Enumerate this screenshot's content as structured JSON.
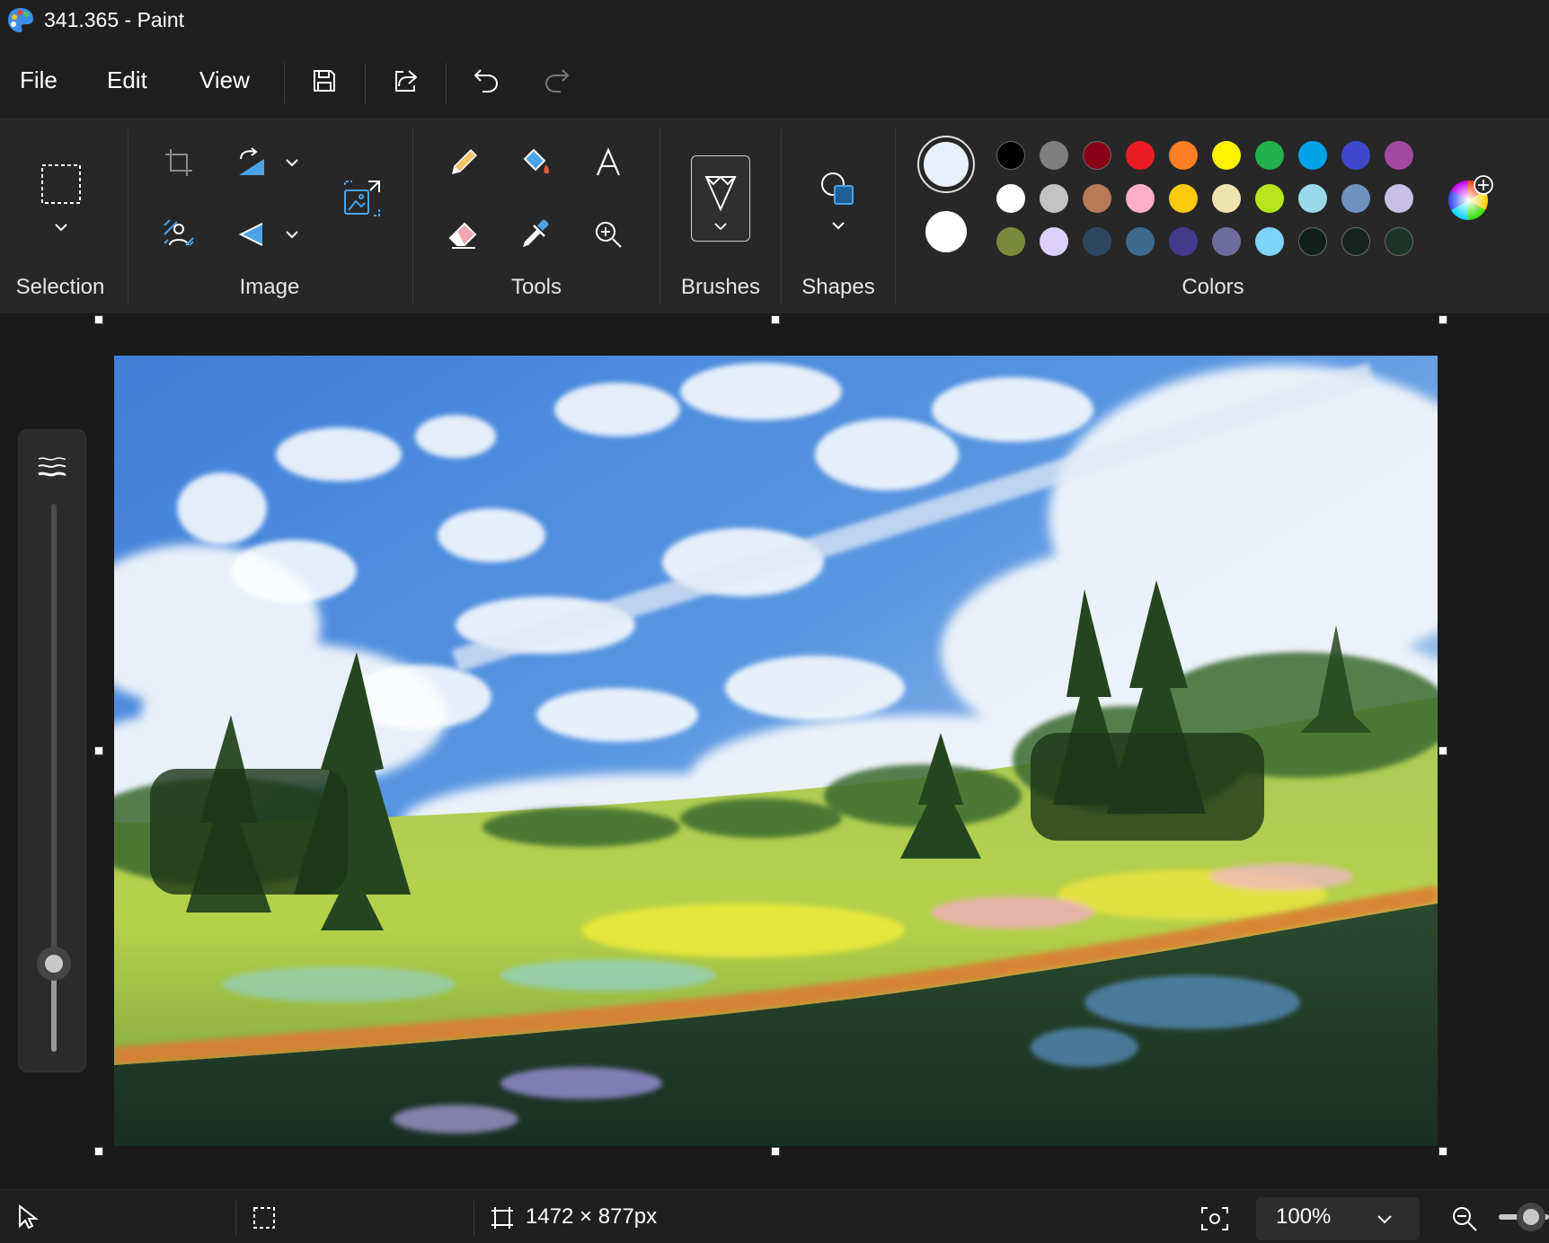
{
  "window": {
    "title": "341.365 - Paint"
  },
  "menu": {
    "file": "File",
    "edit": "Edit",
    "view": "View"
  },
  "ribbon": {
    "groups": {
      "selection": "Selection",
      "image": "Image",
      "tools": "Tools",
      "brushes": "Brushes",
      "shapes": "Shapes",
      "colors": "Colors"
    }
  },
  "colors": {
    "primary": "#e6f0ff",
    "secondary": "#ffffff",
    "palette": [
      [
        "#000000",
        "#7f7f7f",
        "#880015",
        "#ed1c24",
        "#ff7f27",
        "#fff200",
        "#22b14c",
        "#00a2e8",
        "#3f48cc",
        "#a349a4"
      ],
      [
        "#ffffff",
        "#c3c3c3",
        "#b97a57",
        "#ffaec9",
        "#ffc90e",
        "#efe4b0",
        "#b5e61d",
        "#99d9ea",
        "#7092be",
        "#c8bfe7"
      ],
      [
        "#7a8a3a",
        "#ddd0fa",
        "#2e4760",
        "#3d6a8c",
        "#433a8e",
        "#6e6c9e",
        "#7dd3f8",
        "#0f1f1a",
        "#142520",
        "#1c3328"
      ]
    ]
  },
  "brush_size": {
    "level": 0.16
  },
  "status": {
    "canvas_size": "1472 × 877px",
    "zoom": "100%"
  }
}
